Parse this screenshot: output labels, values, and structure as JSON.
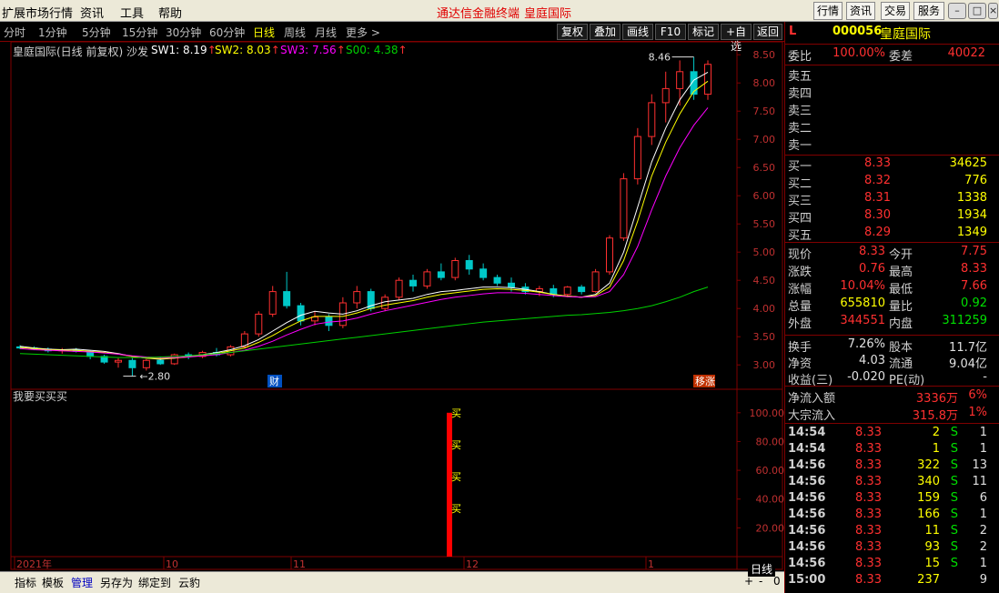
{
  "menu": {
    "items": [
      "扩展市场行情",
      "资讯",
      "工具",
      "帮助"
    ],
    "center_title": "通达信金融终端",
    "center_stock": "皇庭国际",
    "right_buttons": [
      "行情",
      "资讯",
      "交易",
      "服务"
    ]
  },
  "periods": {
    "items": [
      "分时",
      "1分钟",
      "5分钟",
      "15分钟",
      "30分钟",
      "60分钟",
      "日线",
      "周线",
      "月线",
      "更多 >"
    ],
    "active": "日线"
  },
  "tools": [
    "复权",
    "叠加",
    "画线",
    "F10",
    "标记",
    "+自选",
    "返回"
  ],
  "indicator": {
    "title": "皇庭国际(日线 前复权) 沙发",
    "sw1": "SW1: 8.19",
    "sw2": "SW2: 8.03",
    "sw3": "SW3: 7.56",
    "s00": "S00: 4.38",
    "colors": {
      "sw1": "#ffffff",
      "sw2": "#ffff00",
      "sw3": "#ff00ff",
      "s00": "#00d000"
    }
  },
  "chart_data": [
    {
      "type": "candlestick",
      "y_ticks": [
        "8.50",
        "8.00",
        "7.50",
        "7.00",
        "6.50",
        "6.00",
        "5.50",
        "5.00",
        "4.50",
        "4.00",
        "3.50",
        "3.00"
      ],
      "ylim": [
        2.6,
        8.6
      ],
      "annotations": {
        "high": "8.46",
        "low": "2.80"
      },
      "markers": {
        "cai": "财",
        "yizhang": "移涨"
      },
      "x_labels": [
        "2021年",
        "10",
        "11",
        "12",
        "1"
      ],
      "series": [
        {
          "name": "SW1",
          "values": [
            3.33,
            3.3,
            3.28,
            3.27,
            3.28,
            3.26,
            3.24,
            3.2,
            3.15,
            3.12,
            3.1,
            3.12,
            3.15,
            3.18,
            3.22,
            3.27,
            3.34,
            3.45,
            3.6,
            3.75,
            3.88,
            3.95,
            3.92,
            3.9,
            3.96,
            4.05,
            4.12,
            4.15,
            4.18,
            4.25,
            4.3,
            4.32,
            4.35,
            4.38,
            4.38,
            4.37,
            4.34,
            4.3,
            4.25,
            4.22,
            4.2,
            4.25,
            4.45,
            5.0,
            5.8,
            6.6,
            7.2,
            7.7,
            8.05,
            8.19
          ]
        },
        {
          "name": "SW2",
          "values": [
            3.31,
            3.29,
            3.27,
            3.26,
            3.26,
            3.24,
            3.22,
            3.19,
            3.15,
            3.12,
            3.11,
            3.12,
            3.14,
            3.17,
            3.2,
            3.25,
            3.3,
            3.4,
            3.52,
            3.66,
            3.78,
            3.86,
            3.86,
            3.86,
            3.92,
            4.0,
            4.06,
            4.1,
            4.14,
            4.2,
            4.25,
            4.28,
            4.31,
            4.34,
            4.35,
            4.34,
            4.32,
            4.29,
            4.25,
            4.22,
            4.2,
            4.23,
            4.38,
            4.85,
            5.55,
            6.35,
            6.95,
            7.45,
            7.85,
            8.03
          ]
        },
        {
          "name": "SW3",
          "values": [
            3.29,
            3.27,
            3.26,
            3.25,
            3.24,
            3.23,
            3.21,
            3.19,
            3.16,
            3.14,
            3.13,
            3.13,
            3.14,
            3.16,
            3.18,
            3.22,
            3.26,
            3.33,
            3.42,
            3.53,
            3.63,
            3.72,
            3.76,
            3.78,
            3.83,
            3.9,
            3.96,
            4.01,
            4.06,
            4.11,
            4.16,
            4.2,
            4.23,
            4.26,
            4.28,
            4.28,
            4.27,
            4.25,
            4.23,
            4.21,
            4.2,
            4.21,
            4.3,
            4.6,
            5.1,
            5.75,
            6.35,
            6.85,
            7.25,
            7.56
          ]
        },
        {
          "name": "S00",
          "values": [
            3.2,
            3.19,
            3.18,
            3.17,
            3.16,
            3.15,
            3.14,
            3.13,
            3.13,
            3.13,
            3.14,
            3.15,
            3.16,
            3.18,
            3.2,
            3.22,
            3.25,
            3.28,
            3.31,
            3.34,
            3.37,
            3.4,
            3.43,
            3.46,
            3.49,
            3.52,
            3.55,
            3.58,
            3.61,
            3.64,
            3.67,
            3.7,
            3.73,
            3.76,
            3.78,
            3.8,
            3.82,
            3.84,
            3.86,
            3.88,
            3.89,
            3.91,
            3.93,
            3.96,
            4.0,
            4.05,
            4.12,
            4.2,
            4.3,
            4.38
          ]
        }
      ],
      "candles": [
        [
          3.32,
          3.35,
          3.28,
          3.3
        ],
        [
          3.3,
          3.33,
          3.26,
          3.28
        ],
        [
          3.28,
          3.31,
          3.22,
          3.25
        ],
        [
          3.25,
          3.3,
          3.2,
          3.27
        ],
        [
          3.27,
          3.3,
          3.22,
          3.24
        ],
        [
          3.24,
          3.26,
          3.1,
          3.15
        ],
        [
          3.15,
          3.18,
          3.02,
          3.05
        ],
        [
          3.05,
          3.12,
          2.95,
          3.08
        ],
        [
          3.08,
          3.12,
          2.8,
          2.95
        ],
        [
          2.95,
          3.1,
          2.9,
          3.08
        ],
        [
          3.08,
          3.15,
          3.0,
          3.02
        ],
        [
          3.02,
          3.2,
          3.0,
          3.18
        ],
        [
          3.18,
          3.22,
          3.1,
          3.15
        ],
        [
          3.15,
          3.25,
          3.12,
          3.22
        ],
        [
          3.22,
          3.3,
          3.15,
          3.18
        ],
        [
          3.18,
          3.35,
          3.15,
          3.32
        ],
        [
          3.32,
          3.6,
          3.3,
          3.55
        ],
        [
          3.55,
          3.95,
          3.5,
          3.9
        ],
        [
          3.9,
          4.4,
          3.85,
          4.3
        ],
        [
          4.3,
          4.65,
          4.0,
          4.05
        ],
        [
          4.05,
          4.1,
          3.7,
          3.78
        ],
        [
          3.78,
          3.95,
          3.7,
          3.85
        ],
        [
          3.85,
          3.9,
          3.6,
          3.7
        ],
        [
          3.7,
          4.2,
          3.65,
          4.1
        ],
        [
          4.1,
          4.4,
          4.0,
          4.3
        ],
        [
          4.3,
          4.35,
          3.95,
          4.0
        ],
        [
          4.0,
          4.25,
          3.95,
          4.2
        ],
        [
          4.2,
          4.55,
          4.15,
          4.5
        ],
        [
          4.5,
          4.6,
          4.3,
          4.4
        ],
        [
          4.4,
          4.7,
          4.35,
          4.65
        ],
        [
          4.65,
          4.8,
          4.5,
          4.55
        ],
        [
          4.55,
          4.9,
          4.5,
          4.85
        ],
        [
          4.85,
          4.95,
          4.6,
          4.7
        ],
        [
          4.7,
          4.8,
          4.5,
          4.55
        ],
        [
          4.55,
          4.6,
          4.4,
          4.45
        ],
        [
          4.45,
          4.55,
          4.3,
          4.38
        ],
        [
          4.38,
          4.45,
          4.25,
          4.3
        ],
        [
          4.3,
          4.4,
          4.22,
          4.35
        ],
        [
          4.35,
          4.42,
          4.2,
          4.25
        ],
        [
          4.25,
          4.4,
          4.2,
          4.38
        ],
        [
          4.38,
          4.42,
          4.25,
          4.3
        ],
        [
          4.3,
          4.7,
          4.28,
          4.65
        ],
        [
          4.65,
          5.3,
          4.6,
          5.25
        ],
        [
          5.25,
          6.4,
          5.2,
          6.3
        ],
        [
          6.3,
          7.2,
          6.2,
          7.05
        ],
        [
          7.05,
          7.8,
          6.9,
          7.65
        ],
        [
          7.65,
          8.2,
          7.3,
          7.9
        ],
        [
          7.9,
          8.4,
          7.6,
          8.2
        ],
        [
          8.2,
          8.46,
          7.7,
          7.8
        ],
        [
          7.8,
          8.4,
          7.7,
          8.33
        ]
      ]
    },
    {
      "type": "bar",
      "title": "我要买买买",
      "y_ticks": [
        "100.00",
        "80.00",
        "60.00",
        "40.00",
        "20.00"
      ],
      "ylim": [
        0,
        110
      ],
      "bar_value": 100,
      "bar_index": 30,
      "signal_labels": [
        "买",
        "买",
        "买",
        "买"
      ]
    }
  ],
  "right_panel": {
    "header": {
      "mark": "L",
      "code": "000056",
      "name": "皇庭国际"
    },
    "weibi": {
      "label": "委比",
      "value": "100.00%",
      "label2": "委差",
      "value2": "40022"
    },
    "sell": [
      {
        "label": "卖五",
        "price": "",
        "vol": ""
      },
      {
        "label": "卖四",
        "price": "",
        "vol": ""
      },
      {
        "label": "卖三",
        "price": "",
        "vol": ""
      },
      {
        "label": "卖二",
        "price": "",
        "vol": ""
      },
      {
        "label": "卖一",
        "price": "",
        "vol": ""
      }
    ],
    "buy": [
      {
        "label": "买一",
        "price": "8.33",
        "vol": "34625"
      },
      {
        "label": "买二",
        "price": "8.32",
        "vol": "776"
      },
      {
        "label": "买三",
        "price": "8.31",
        "vol": "1338"
      },
      {
        "label": "买四",
        "price": "8.30",
        "vol": "1934"
      },
      {
        "label": "买五",
        "price": "8.29",
        "vol": "1349"
      }
    ],
    "quote": [
      {
        "l1": "现价",
        "v1": "8.33",
        "c1": "red",
        "l2": "今开",
        "v2": "7.75",
        "c2": "red"
      },
      {
        "l1": "涨跌",
        "v1": "0.76",
        "c1": "red",
        "l2": "最高",
        "v2": "8.33",
        "c2": "red"
      },
      {
        "l1": "涨幅",
        "v1": "10.04%",
        "c1": "red",
        "l2": "最低",
        "v2": "7.66",
        "c2": "red"
      },
      {
        "l1": "总量",
        "v1": "655810",
        "c1": "yel",
        "l2": "量比",
        "v2": "0.92",
        "c2": "grn"
      },
      {
        "l1": "外盘",
        "v1": "344551",
        "c1": "red",
        "l2": "内盘",
        "v2": "311259",
        "c2": "grn"
      }
    ],
    "finance": [
      {
        "l1": "换手",
        "v1": "7.26%",
        "l2": "股本",
        "v2": "11.7亿"
      },
      {
        "l1": "净资",
        "v1": "4.03",
        "l2": "流通",
        "v2": "9.04亿"
      },
      {
        "l1": "收益(三)",
        "v1": "-0.020",
        "l2": "PE(动)",
        "v2": "-"
      }
    ],
    "flow": [
      {
        "label": "净流入额",
        "v1": "3336万",
        "v2": "6%"
      },
      {
        "label": "大宗流入",
        "v1": "315.8万",
        "v2": "1%"
      }
    ],
    "ticks": [
      {
        "t": "14:54",
        "p": "8.33",
        "v": "2",
        "s": "S",
        "n": "1"
      },
      {
        "t": "14:54",
        "p": "8.33",
        "v": "1",
        "s": "S",
        "n": "1"
      },
      {
        "t": "14:56",
        "p": "8.33",
        "v": "322",
        "s": "S",
        "n": "13"
      },
      {
        "t": "14:56",
        "p": "8.33",
        "v": "340",
        "s": "S",
        "n": "11"
      },
      {
        "t": "14:56",
        "p": "8.33",
        "v": "159",
        "s": "S",
        "n": "6"
      },
      {
        "t": "14:56",
        "p": "8.33",
        "v": "166",
        "s": "S",
        "n": "1"
      },
      {
        "t": "14:56",
        "p": "8.33",
        "v": "11",
        "s": "S",
        "n": "2"
      },
      {
        "t": "14:56",
        "p": "8.33",
        "v": "93",
        "s": "S",
        "n": "2"
      },
      {
        "t": "14:56",
        "p": "8.33",
        "v": "15",
        "s": "S",
        "n": "1"
      },
      {
        "t": "15:00",
        "p": "8.33",
        "v": "237",
        "s": "",
        "n": "9"
      }
    ]
  },
  "bottom": {
    "items": [
      "指标",
      "模板",
      "管理",
      "另存为",
      "绑定到",
      "云豹"
    ],
    "active": "管理",
    "period_label": "日线",
    "zoom_plus": "+",
    "zoom_minus": "-",
    "zoom_zero": "0"
  }
}
